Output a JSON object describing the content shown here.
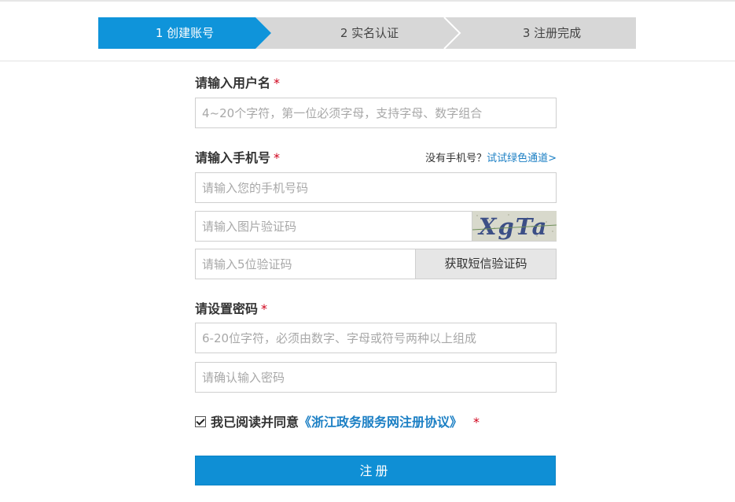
{
  "steps": [
    {
      "label": "1 创建账号",
      "active": true
    },
    {
      "label": "2 实名认证",
      "active": false
    },
    {
      "label": "3 注册完成",
      "active": false
    }
  ],
  "colors": {
    "active_step": "#0f94da",
    "inactive_step": "#d7d7d7",
    "link": "#1b7fc4",
    "required": "#d0021b",
    "primary_button": "#0f8fd5"
  },
  "username": {
    "label": "请输入用户名",
    "required_mark": "*",
    "placeholder": "4~20个字符，第一位必须字母，支持字母、数字组合"
  },
  "phone": {
    "label": "请输入手机号",
    "required_mark": "*",
    "no_phone_text": "没有手机号？",
    "green_channel_link": "试试绿色通道>",
    "placeholder": "请输入您的手机号码",
    "captcha_placeholder": "请输入图片验证码",
    "captcha_text": "XgTa",
    "sms_placeholder": "请输入5位验证码",
    "sms_button": "获取短信验证码"
  },
  "password": {
    "label": "请设置密码",
    "required_mark": "*",
    "placeholder": "6-20位字符，必须由数字、字母或符号两种以上组成",
    "confirm_placeholder": "请确认输入密码"
  },
  "agreement": {
    "checked": true,
    "text": "我已阅读并同意",
    "link": "《浙江政务服务网注册协议》",
    "required_mark": "*"
  },
  "submit_label": "注册"
}
